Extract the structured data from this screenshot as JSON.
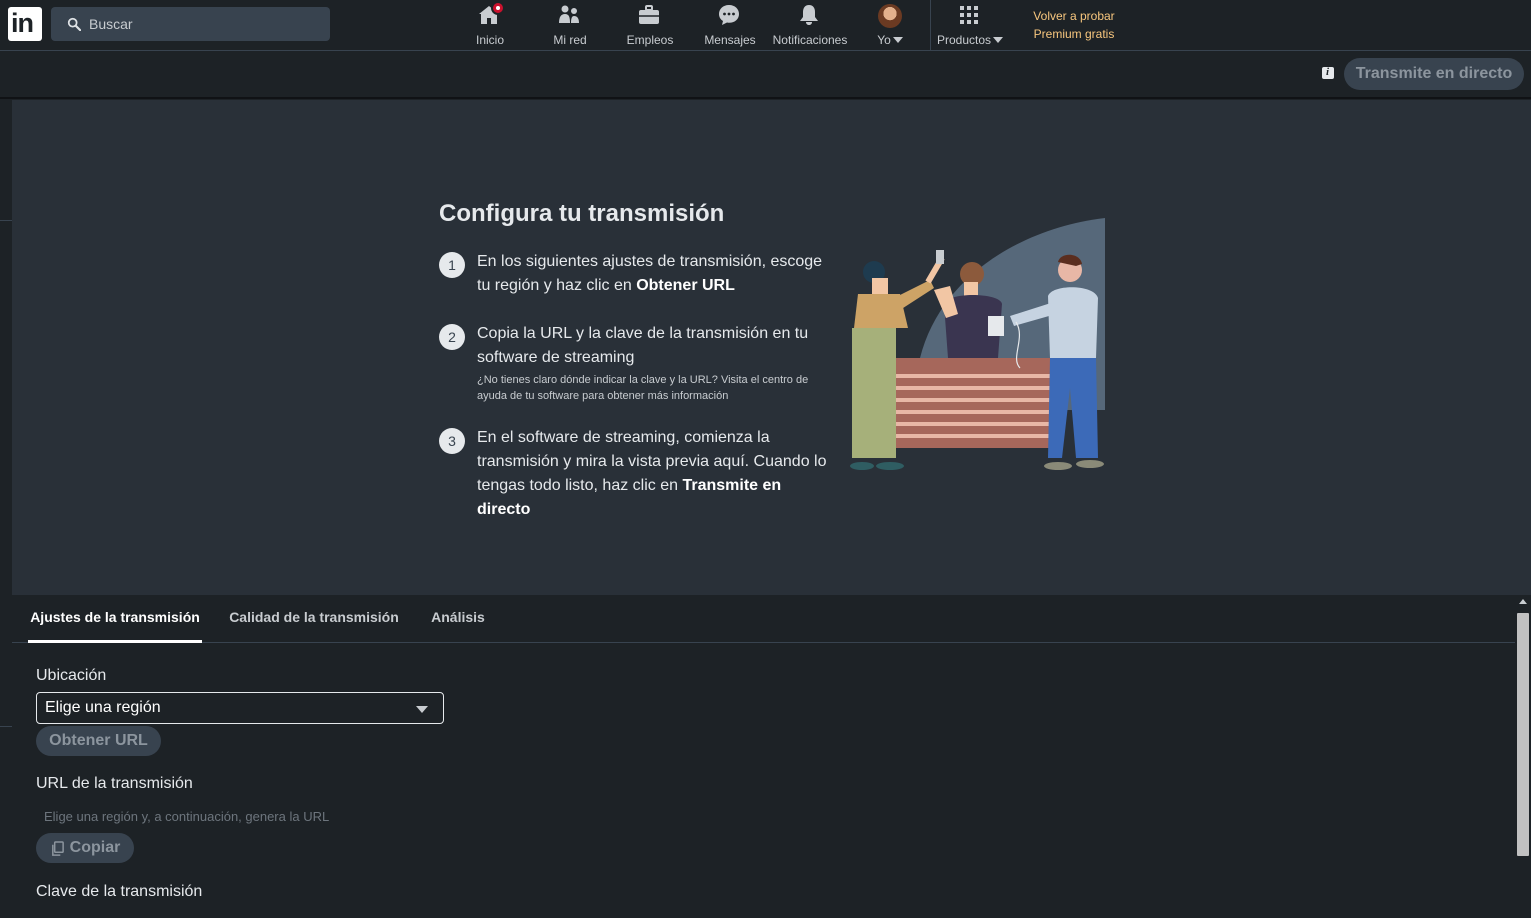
{
  "nav": {
    "search_placeholder": "Buscar",
    "items": [
      {
        "label": "Inicio"
      },
      {
        "label": "Mi red"
      },
      {
        "label": "Empleos"
      },
      {
        "label": "Mensajes"
      },
      {
        "label": "Notificaciones"
      },
      {
        "label": "Yo"
      },
      {
        "label": "Productos"
      }
    ],
    "premium_line1": "Volver a probar",
    "premium_line2": "Premium gratis"
  },
  "header": {
    "live_button": "Transmite en directo"
  },
  "hero": {
    "title": "Configura tu transmisión",
    "steps": [
      {
        "num": "1",
        "text_a": "En los siguientes ajustes de transmisión, escoge tu región y haz clic en ",
        "bold": "Obtener URL"
      },
      {
        "num": "2",
        "text_a": "Copia la URL y la clave de la transmisión en tu software de streaming",
        "sub": "¿No tienes claro dónde indicar la clave y la URL? Visita el centro de ayuda de tu software para obtener más información"
      },
      {
        "num": "3",
        "text_a": "En el software de streaming, comienza la transmisión y mira la vista previa aquí. Cuando lo tengas todo listo, haz clic en ",
        "bold": "Transmite en directo"
      }
    ]
  },
  "tabs": [
    {
      "label": "Ajustes de la transmisión"
    },
    {
      "label": "Calidad de la transmisión"
    },
    {
      "label": "Análisis"
    }
  ],
  "settings": {
    "location_label": "Ubicación",
    "region_value": "Elige una región",
    "get_url_button": "Obtener URL",
    "url_label": "URL de la transmisión",
    "url_hint": "Elige una región y, a continuación, genera la URL",
    "copy_button": "Copiar",
    "key_label": "Clave de la transmisión"
  },
  "colors": {
    "background": "#1d2226",
    "hero_background": "#293038",
    "premium_text": "#f8c77e",
    "notification_badge": "#cb112d"
  }
}
